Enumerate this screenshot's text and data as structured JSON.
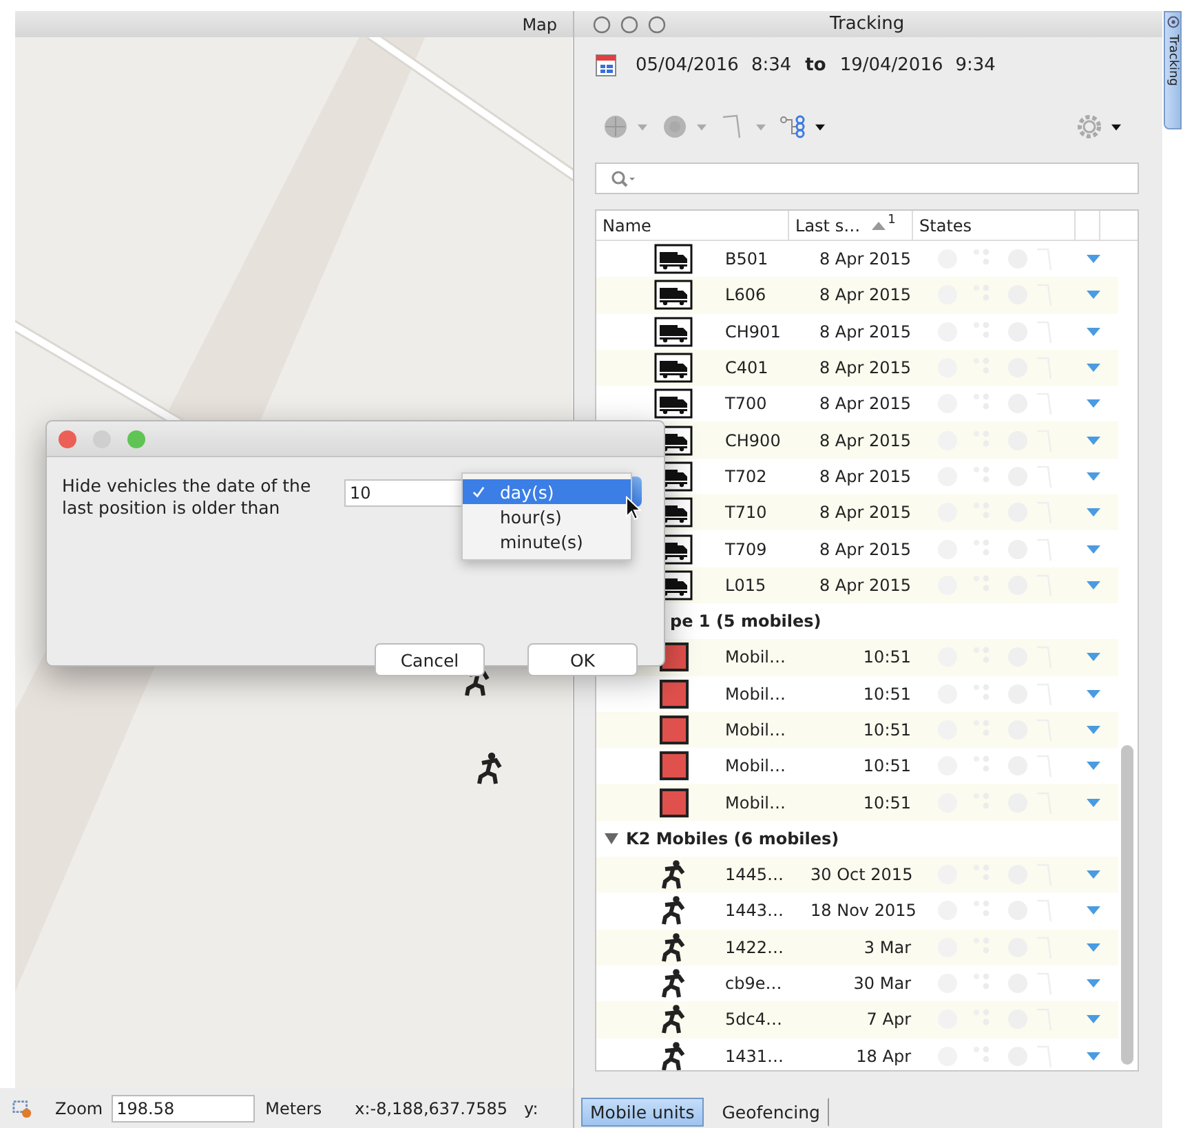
{
  "map": {
    "title": "Map"
  },
  "map_status": {
    "zoom_label": "Zoom",
    "zoom_value": "198.58",
    "unit": "Meters",
    "x_coord": "x:-8,188,637.7585",
    "y_coord": "y:"
  },
  "tracking": {
    "title": "Tracking",
    "range": {
      "from_date": "05/04/2016",
      "from_time": "8:34",
      "separator": "to",
      "to_date": "19/04/2016",
      "to_time": "9:34"
    },
    "table": {
      "columns": [
        {
          "label": "Name"
        },
        {
          "label": "Last s…",
          "sort_rank": "1"
        },
        {
          "label": "States"
        }
      ],
      "groups": [
        {
          "rows": [
            {
              "kind": "truck",
              "name": "B501",
              "last_seen": "8 Apr 2015"
            },
            {
              "kind": "truck",
              "name": "L606",
              "last_seen": "8 Apr 2015"
            },
            {
              "kind": "truck",
              "name": "CH901",
              "last_seen": "8 Apr 2015"
            },
            {
              "kind": "truck",
              "name": "C401",
              "last_seen": "8 Apr 2015"
            },
            {
              "kind": "truck",
              "name": "T700",
              "last_seen": "8 Apr 2015"
            },
            {
              "kind": "truck",
              "name": "CH900",
              "last_seen": "8 Apr 2015"
            },
            {
              "kind": "truck",
              "name": "T702",
              "last_seen": "8 Apr 2015"
            },
            {
              "kind": "truck",
              "name": "T710",
              "last_seen": "8 Apr 2015"
            },
            {
              "kind": "truck",
              "name": "T709",
              "last_seen": "8 Apr 2015"
            },
            {
              "kind": "truck",
              "name": "L015",
              "last_seen": "8 Apr 2015"
            }
          ]
        },
        {
          "label": "pe 1 (5 mobiles)",
          "rows": [
            {
              "kind": "square",
              "name": "Mobil…",
              "last_seen": "10:51"
            },
            {
              "kind": "square",
              "name": "Mobil…",
              "last_seen": "10:51"
            },
            {
              "kind": "square",
              "name": "Mobil…",
              "last_seen": "10:51"
            },
            {
              "kind": "square",
              "name": "Mobil…",
              "last_seen": "10:51"
            },
            {
              "kind": "square",
              "name": "Mobil…",
              "last_seen": "10:51"
            }
          ]
        },
        {
          "label": "K2 Mobiles (6 mobiles)",
          "expanded": true,
          "rows": [
            {
              "kind": "runner",
              "name": "1445…",
              "last_seen": "30 Oct 2015"
            },
            {
              "kind": "runner",
              "name": "1443…",
              "last_seen": "18 Nov 2015"
            },
            {
              "kind": "runner",
              "name": "1422…",
              "last_seen": "3 Mar"
            },
            {
              "kind": "runner",
              "name": "cb9e…",
              "last_seen": "30 Mar"
            },
            {
              "kind": "runner",
              "name": "5dc4…",
              "last_seen": "7 Apr"
            },
            {
              "kind": "runner",
              "name": "1431…",
              "last_seen": "18 Apr"
            }
          ]
        }
      ]
    },
    "bottom_tabs": [
      {
        "label": "Mobile units",
        "selected": true
      },
      {
        "label": "Geofencing",
        "selected": false
      }
    ]
  },
  "side_tab": {
    "label": "Tracking"
  },
  "dialog": {
    "message": "Hide vehicles the date of the last position is older than",
    "value": "10",
    "unit_options": [
      {
        "label": "day(s)",
        "selected": true
      },
      {
        "label": "hour(s)",
        "selected": false
      },
      {
        "label": "minute(s)",
        "selected": false
      }
    ],
    "buttons": [
      {
        "label": "Cancel"
      },
      {
        "label": "OK"
      }
    ]
  }
}
